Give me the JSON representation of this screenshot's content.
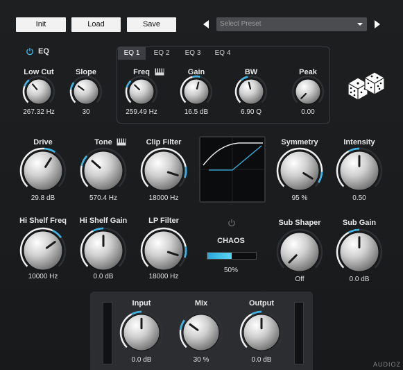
{
  "toolbar": {
    "init_label": "Init",
    "load_label": "Load",
    "save_label": "Save",
    "preset_placeholder": "Select Preset"
  },
  "eq": {
    "title": "EQ",
    "tabs": [
      "EQ 1",
      "EQ 2",
      "EQ 3",
      "EQ 4"
    ],
    "active_tab": 0
  },
  "knobs": {
    "low_cut": {
      "label": "Low Cut",
      "value": "267.32 Hz",
      "level": 0.35
    },
    "slope": {
      "label": "Slope",
      "value": "30",
      "level": 0.3
    },
    "freq": {
      "label": "Freq",
      "value": "259.49 Hz",
      "level": 0.33
    },
    "gain": {
      "label": "Gain",
      "value": "16.5 dB",
      "level": 0.55
    },
    "bw": {
      "label": "BW",
      "value": "6.90 Q",
      "level": 0.45
    },
    "peak": {
      "label": "Peak",
      "value": "0.00",
      "level": 0.0
    },
    "drive": {
      "label": "Drive",
      "value": "29.8 dB",
      "level": 0.62
    },
    "tone": {
      "label": "Tone",
      "value": "570.4 Hz",
      "level": 0.32
    },
    "clip_filter": {
      "label": "Clip Filter",
      "value": "18000 Hz",
      "level": 0.9
    },
    "symmetry": {
      "label": "Symmetry",
      "value": "95 %",
      "level": 0.95
    },
    "intensity": {
      "label": "Intensity",
      "value": "0.50",
      "level": 0.5
    },
    "hi_shelf_freq": {
      "label": "Hi Shelf Freq",
      "value": "10000 Hz",
      "level": 0.7
    },
    "hi_shelf_gain": {
      "label": "Hi Shelf Gain",
      "value": "0.0 dB",
      "level": 0.5
    },
    "lp_filter": {
      "label": "LP Filter",
      "value": "18000 Hz",
      "level": 0.9
    },
    "sub_shaper": {
      "label": "Sub Shaper",
      "value": "Off",
      "level": 0.0
    },
    "sub_gain": {
      "label": "Sub Gain",
      "value": "0.0 dB",
      "level": 0.5
    },
    "input": {
      "label": "Input",
      "value": "0.0 dB",
      "level": 0.5
    },
    "mix": {
      "label": "Mix",
      "value": "30 %",
      "level": 0.3
    },
    "output": {
      "label": "Output",
      "value": "0.0 dB",
      "level": 0.5
    }
  },
  "chaos": {
    "label": "CHAOS",
    "value": "50%",
    "level": 0.5
  },
  "watermark": "AUDIOZ",
  "colors": {
    "accent": "#3ab4e6",
    "background": "#1b1d1f"
  }
}
